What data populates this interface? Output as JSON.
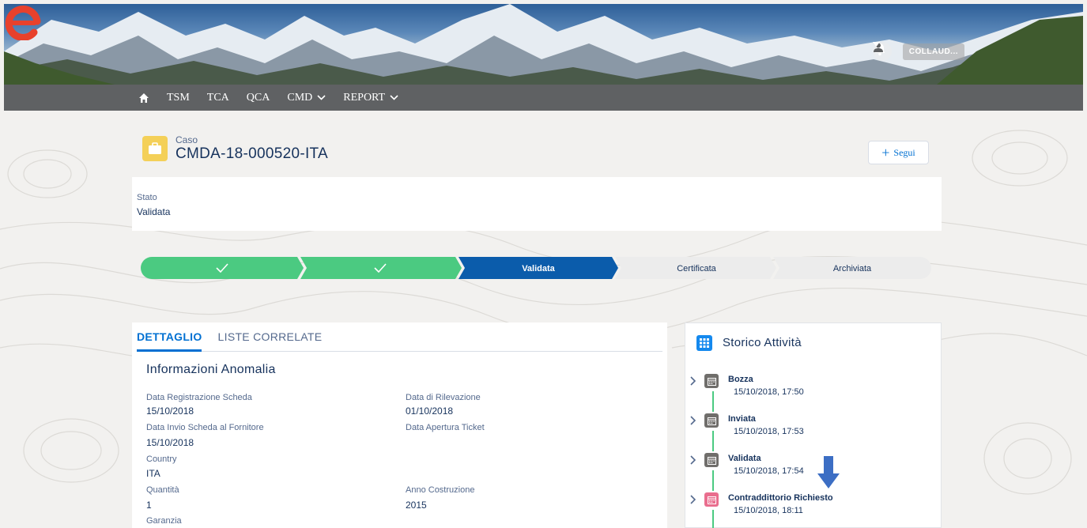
{
  "header": {
    "user_name": "COLLAUD..."
  },
  "nav": {
    "items": [
      {
        "label": "TSM",
        "has_dropdown": false
      },
      {
        "label": "TCA",
        "has_dropdown": false
      },
      {
        "label": "QCA",
        "has_dropdown": false
      },
      {
        "label": "CMD",
        "has_dropdown": true
      },
      {
        "label": "REPORT",
        "has_dropdown": true
      }
    ]
  },
  "record": {
    "type_label": "Caso",
    "title": "CMDA-18-000520-ITA",
    "follow_label": "Segui"
  },
  "status": {
    "label": "Stato",
    "value": "Validata"
  },
  "path": {
    "steps": [
      {
        "label": "",
        "state": "complete"
      },
      {
        "label": "",
        "state": "complete"
      },
      {
        "label": "Validata",
        "state": "current"
      },
      {
        "label": "Certificata",
        "state": "incomplete"
      },
      {
        "label": "Archiviata",
        "state": "incomplete"
      }
    ]
  },
  "detail": {
    "tabs": [
      "DETTAGLIO",
      "LISTE CORRELATE"
    ],
    "active_tab": "DETTAGLIO",
    "section_title": "Informazioni Anomalia",
    "fields": {
      "data_registrazione": {
        "label": "Data Registrazione Scheda",
        "value": "15/10/2018"
      },
      "data_rilevazione": {
        "label": "Data di Rilevazione",
        "value": "01/10/2018"
      },
      "data_invio": {
        "label": "Data Invio Scheda al Fornitore",
        "value": "15/10/2018"
      },
      "data_apertura": {
        "label": "Data Apertura Ticket",
        "value": ""
      },
      "country": {
        "label": "Country",
        "value": "ITA"
      },
      "quantita": {
        "label": "Quantità",
        "value": "1"
      },
      "anno_costruzione": {
        "label": "Anno Costruzione",
        "value": "2015"
      },
      "garanzia": {
        "label": "Garanzia",
        "value": ""
      }
    }
  },
  "activity": {
    "title": "Storico Attività",
    "items": [
      {
        "title": "Bozza",
        "date": "15/10/2018, 17:50",
        "color": "#706e6b"
      },
      {
        "title": "Inviata",
        "date": "15/10/2018, 17:53",
        "color": "#706e6b"
      },
      {
        "title": "Validata",
        "date": "15/10/2018, 17:54",
        "color": "#706e6b"
      },
      {
        "title": "Contraddittorio Richiesto",
        "date": "15/10/2018, 18:11",
        "color": "#e96e8e"
      }
    ]
  },
  "colors": {
    "path_complete": "#4bca81",
    "path_current": "#0b5cab",
    "path_incomplete": "#ececec",
    "brand": "#0070d2",
    "annotation_arrow": "#3c6ec4"
  }
}
